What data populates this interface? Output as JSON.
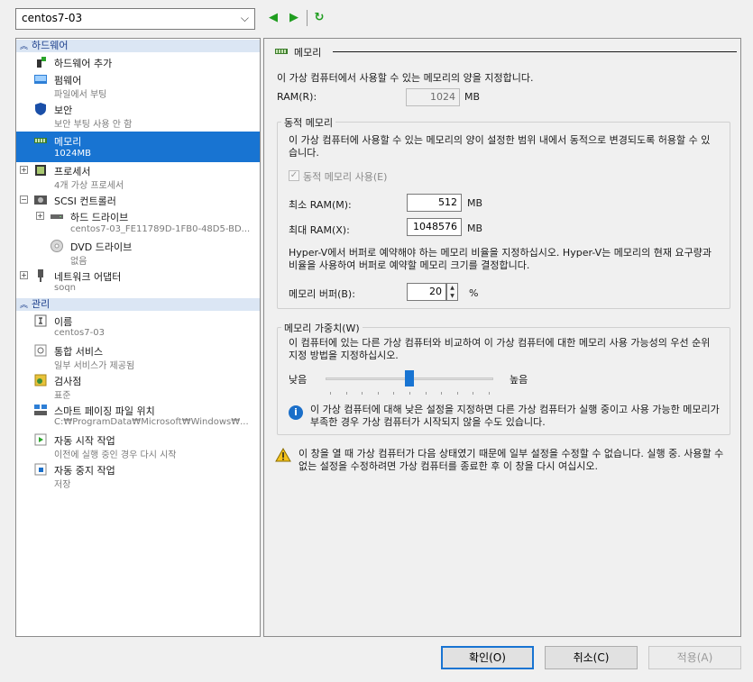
{
  "vm_selector": {
    "value": "centos7-03"
  },
  "tree": {
    "hardware_header": "하드웨어",
    "management_header": "관리",
    "items": [
      {
        "title": "하드웨어 추가",
        "subtitle": ""
      },
      {
        "title": "펌웨어",
        "subtitle": "파일에서 부팅"
      },
      {
        "title": "보안",
        "subtitle": "보안 부팅 사용 안 함"
      },
      {
        "title": "메모리",
        "subtitle": "1024MB"
      },
      {
        "title": "프로세서",
        "subtitle": "4개 가상 프로세서"
      },
      {
        "title": "SCSI 컨트롤러",
        "subtitle": ""
      },
      {
        "title": "하드 드라이브",
        "subtitle": "centos7-03_FE11789D-1FB0-48D5-BD..."
      },
      {
        "title": "DVD 드라이브",
        "subtitle": "없음"
      },
      {
        "title": "네트워크 어댑터",
        "subtitle": "soqn"
      },
      {
        "title": "이름",
        "subtitle": "centos7-03"
      },
      {
        "title": "통합 서비스",
        "subtitle": "일부 서비스가 제공됨"
      },
      {
        "title": "검사점",
        "subtitle": "표준"
      },
      {
        "title": "스마트 페이징 파일 위치",
        "subtitle": "C:₩ProgramData₩Microsoft₩Windows₩..."
      },
      {
        "title": "자동 시작 작업",
        "subtitle": "이전에 실행 중인 경우 다시 시작"
      },
      {
        "title": "자동 중지 작업",
        "subtitle": "저장"
      }
    ]
  },
  "memory": {
    "section_title": "메모리",
    "description": "이 가상 컴퓨터에서 사용할 수 있는 메모리의 양을 지정합니다.",
    "ram_label": "RAM(R):",
    "ram_value": "1024",
    "unit_mb": "MB",
    "dynamic": {
      "group_title": "동적 메모리",
      "description": "이 가상 컴퓨터에 사용할 수 있는 메모리의 양이 설정한 범위 내에서 동적으로 변경되도록 허용할 수 있습니다.",
      "enable_label": "동적 메모리 사용(E)",
      "min_label": "최소 RAM(M):",
      "min_value": "512",
      "max_label": "최대 RAM(X):",
      "max_value": "1048576",
      "buffer_description": "Hyper-V에서 버퍼로 예약해야 하는 메모리 비율을 지정하십시오. Hyper-V는 메모리의 현재 요구량과 비율을 사용하여 버퍼로 예약할 메모리 크기를 결정합니다.",
      "buffer_label": "메모리 버퍼(B):",
      "buffer_value": "20",
      "percent": "%"
    },
    "weight": {
      "group_title": "메모리 가중치(W)",
      "description": "이 컴퓨터에 있는 다른 가상 컴퓨터와 비교하여 이 가상 컴퓨터에 대한 메모리 사용 가능성의 우선 순위 지정 방법을 지정하십시오.",
      "low_label": "낮음",
      "high_label": "높음",
      "level": 0.5,
      "info_text": "이 가상 컴퓨터에 대해 낮은 설정을 지정하면 다른 가상 컴퓨터가 실행 중이고 사용 가능한 메모리가 부족한 경우 가상 컴퓨터가 시작되지 않을 수도 있습니다."
    },
    "warning_text": "이 창을 열 때 가상 컴퓨터가 다음 상태였기 때문에 일부 설정을 수정할 수 없습니다. 실행 중. 사용할 수 없는 설정을 수정하려면 가상 컴퓨터를 종료한 후 이 창을 다시 여십시오."
  },
  "buttons": {
    "ok": "확인(O)",
    "cancel": "취소(C)",
    "apply": "적용(A)"
  },
  "colors": {
    "selection": "#1874d2",
    "header_bg": "#dbe6f4",
    "nav_green": "#1f9d1f"
  }
}
